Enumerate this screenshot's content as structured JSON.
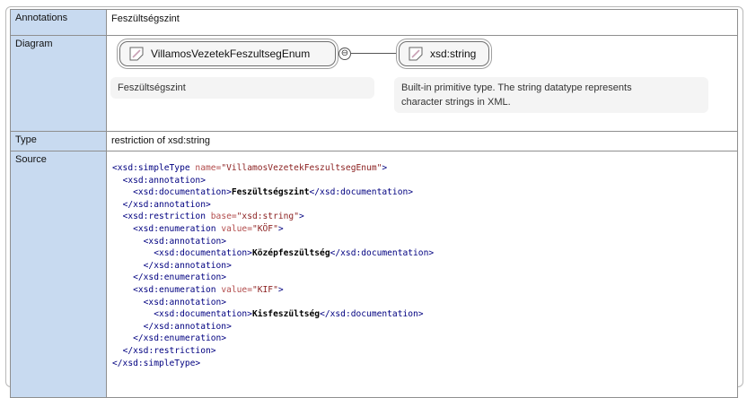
{
  "labels": {
    "annotations": "Annotations",
    "diagram": "Diagram",
    "type": "Type",
    "source": "Source"
  },
  "annotation_text": "Feszültségszint",
  "diagram": {
    "main_node": "VillamosVezetekFeszultsegEnum",
    "connector_symbol": "⊖",
    "target_node": "xsd:string",
    "main_doc": "Feszültségszint",
    "target_doc_line1": "Built-in primitive type. The string datatype represents",
    "target_doc_line2": "character strings in XML.",
    "icon": "simple-type-icon"
  },
  "type_text": "restriction of xsd:string",
  "source_lines": [
    {
      "indent": 0,
      "parts": [
        [
          "t",
          "<xsd:simpleType "
        ],
        [
          "a",
          "name="
        ],
        [
          "v",
          "\"VillamosVezetekFeszultsegEnum\""
        ],
        [
          "t",
          ">"
        ]
      ]
    },
    {
      "indent": 1,
      "parts": [
        [
          "t",
          "<xsd:annotation>"
        ]
      ]
    },
    {
      "indent": 2,
      "parts": [
        [
          "t",
          "<xsd:documentation>"
        ],
        [
          "x",
          "Feszültségszint"
        ],
        [
          "t",
          "</xsd:documentation>"
        ]
      ]
    },
    {
      "indent": 1,
      "parts": [
        [
          "t",
          "</xsd:annotation>"
        ]
      ]
    },
    {
      "indent": 1,
      "parts": [
        [
          "t",
          "<xsd:restriction "
        ],
        [
          "a",
          "base="
        ],
        [
          "v",
          "\"xsd:string\""
        ],
        [
          "t",
          ">"
        ]
      ]
    },
    {
      "indent": 2,
      "parts": [
        [
          "t",
          "<xsd:enumeration "
        ],
        [
          "a",
          "value="
        ],
        [
          "v",
          "\"KÖF\""
        ],
        [
          "t",
          ">"
        ]
      ]
    },
    {
      "indent": 3,
      "parts": [
        [
          "t",
          "<xsd:annotation>"
        ]
      ]
    },
    {
      "indent": 4,
      "parts": [
        [
          "t",
          "<xsd:documentation>"
        ],
        [
          "x",
          "Középfeszültség"
        ],
        [
          "t",
          "</xsd:documentation>"
        ]
      ]
    },
    {
      "indent": 3,
      "parts": [
        [
          "t",
          "</xsd:annotation>"
        ]
      ]
    },
    {
      "indent": 2,
      "parts": [
        [
          "t",
          "</xsd:enumeration>"
        ]
      ]
    },
    {
      "indent": 2,
      "parts": [
        [
          "t",
          "<xsd:enumeration "
        ],
        [
          "a",
          "value="
        ],
        [
          "v",
          "\"KIF\""
        ],
        [
          "t",
          ">"
        ]
      ]
    },
    {
      "indent": 3,
      "parts": [
        [
          "t",
          "<xsd:annotation>"
        ]
      ]
    },
    {
      "indent": 4,
      "parts": [
        [
          "t",
          "<xsd:documentation>"
        ],
        [
          "x",
          "Kisfeszültség"
        ],
        [
          "t",
          "</xsd:documentation>"
        ]
      ]
    },
    {
      "indent": 3,
      "parts": [
        [
          "t",
          "</xsd:annotation>"
        ]
      ]
    },
    {
      "indent": 2,
      "parts": [
        [
          "t",
          "</xsd:enumeration>"
        ]
      ]
    },
    {
      "indent": 1,
      "parts": [
        [
          "t",
          "</xsd:restriction>"
        ]
      ]
    },
    {
      "indent": 0,
      "parts": [
        [
          "t",
          "</xsd:simpleType>"
        ]
      ]
    }
  ],
  "colors": {
    "label_bg": "#c8daf0",
    "tag": "#000080",
    "attr": "#b24b4b",
    "attr_value": "#8a1e1e"
  }
}
